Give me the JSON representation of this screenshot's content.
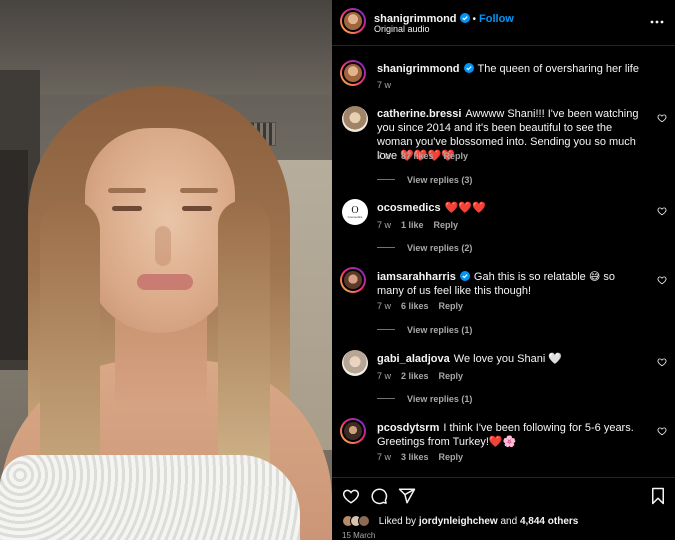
{
  "post": {
    "author": "shanigrimmond",
    "follow_label": "Follow",
    "audio": "Original audio",
    "separator": "•",
    "caption": "The queen of oversharing her life",
    "caption_time": "7 w"
  },
  "comments": [
    {
      "username": "catherine.bressi",
      "text": "Awwww Shani!!! I've been watching you since 2014 and it's been beautiful to see the woman you've blossomed into. Sending you so much love ❤️❤️❤️❤️",
      "time": "7 w",
      "likes": "87 likes",
      "reply_label": "Reply",
      "view_replies": "View replies (3)"
    },
    {
      "username": "ocosmedics",
      "text": "❤️❤️❤️",
      "time": "7 w",
      "likes": "1 like",
      "reply_label": "Reply",
      "view_replies": "View replies (2)",
      "avatar_letter": "O",
      "avatar_text": "Cosmedics"
    },
    {
      "username": "iamsarahharris",
      "text": "Gah this is so relatable 😅 so many of us feel like this though!",
      "time": "7 w",
      "likes": "6 likes",
      "reply_label": "Reply",
      "view_replies": "View replies (1)"
    },
    {
      "username": "gabi_aladjova",
      "text": "We love you Shani 🤍",
      "time": "7 w",
      "likes": "2 likes",
      "reply_label": "Reply",
      "view_replies": "View replies (1)"
    },
    {
      "username": "pcosdytsrm",
      "text": "I think I've been following for 5-6 years. Greetings from Turkey!❤️🌸",
      "time": "7 w",
      "likes": "3 likes",
      "reply_label": "Reply"
    }
  ],
  "footer": {
    "liked_prefix": "Liked by",
    "liked_user": "jordynleighchew",
    "liked_and": "and",
    "liked_others": "4,844 others",
    "date": "15 March"
  },
  "icons": {
    "more": "more-options-icon",
    "like": "heart-icon",
    "comment": "comment-icon",
    "share": "share-icon",
    "save": "bookmark-icon",
    "verified": "verified-badge-icon"
  },
  "colors": {
    "background": "#000000",
    "text": "#f5f5f5",
    "muted": "#a8a8a8",
    "link": "#0095f6",
    "verified": "#0095f6"
  }
}
